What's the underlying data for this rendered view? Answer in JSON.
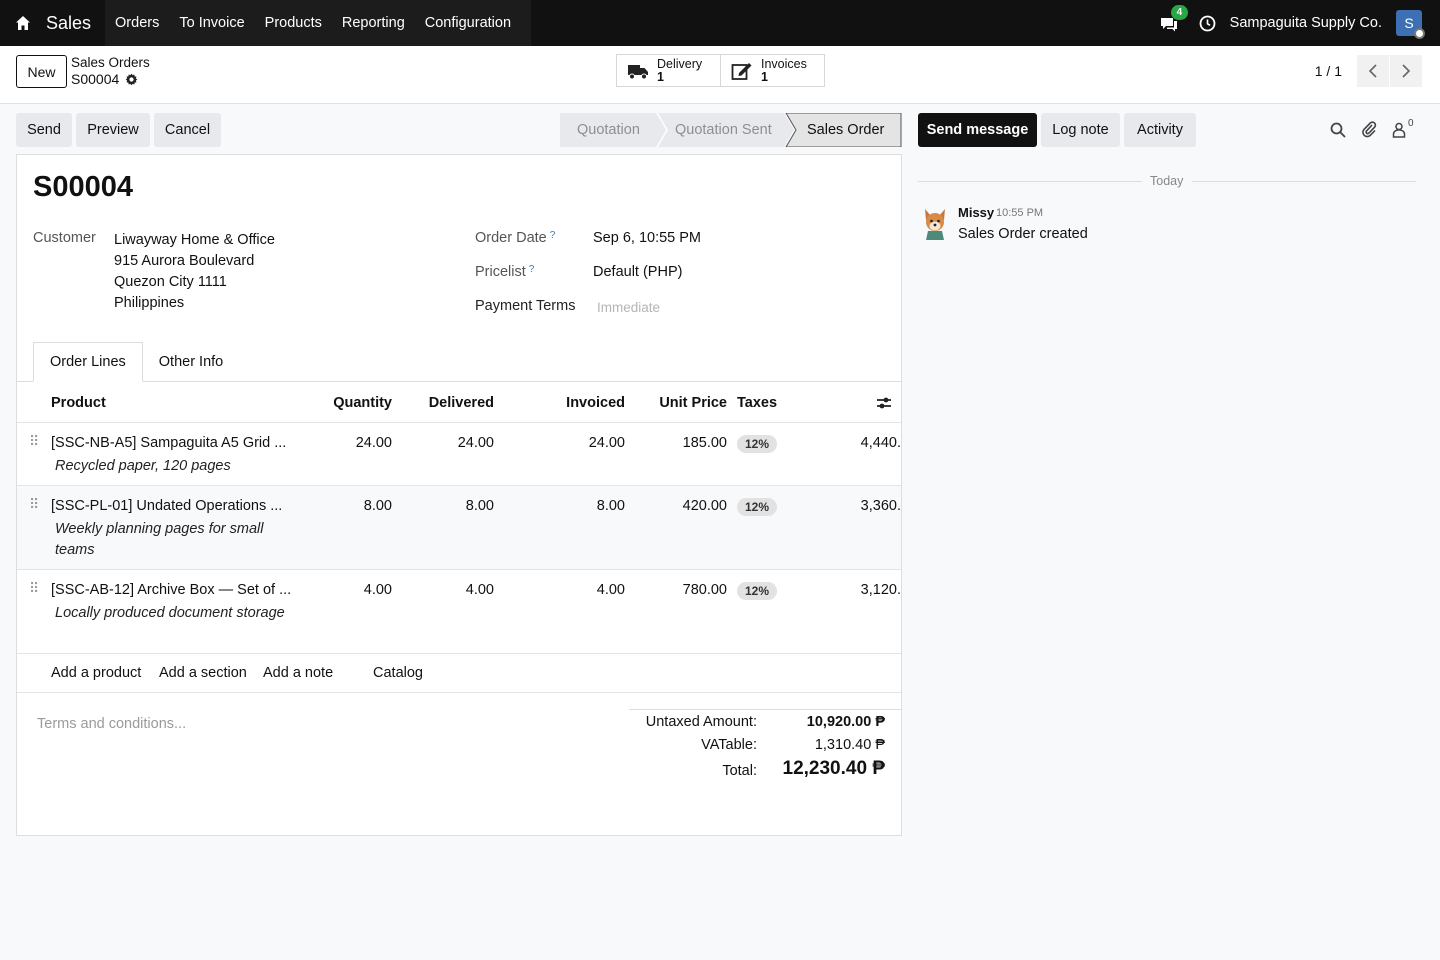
{
  "navbar": {
    "app_name": "Sales",
    "menu": [
      "Orders",
      "To Invoice",
      "Products",
      "Reporting",
      "Configuration"
    ],
    "chat_count": "4",
    "company": "Sampaguita Supply Co.",
    "avatar_initial": "S"
  },
  "control": {
    "new_label": "New",
    "breadcrumb_parent": "Sales Orders",
    "breadcrumb_current": "S00004",
    "smart_buttons": [
      {
        "label": "Delivery",
        "count": "1",
        "icon": "truck-icon"
      },
      {
        "label": "Invoices",
        "count": "1",
        "icon": "edit-invoice-icon"
      }
    ],
    "pager": "1 / 1"
  },
  "actions": {
    "send": "Send",
    "preview": "Preview",
    "cancel": "Cancel"
  },
  "statusbar": {
    "stages": [
      "Quotation",
      "Quotation Sent",
      "Sales Order"
    ],
    "active": "Sales Order"
  },
  "form": {
    "title": "S00004",
    "customer_label": "Customer",
    "customer_lines": [
      "Liwayway Home & Office",
      "915 Aurora Boulevard",
      "Quezon City 1111",
      "Philippines"
    ],
    "order_date_label": "Order Date",
    "order_date": "Sep 6, 10:55 PM",
    "pricelist_label": "Pricelist",
    "pricelist": "Default (PHP)",
    "payment_terms_label": "Payment Terms",
    "payment_terms_placeholder": "Immediate",
    "help_mark": "?",
    "tabs": [
      "Order Lines",
      "Other Info"
    ],
    "columns": {
      "product": "Product",
      "quantity": "Quantity",
      "delivered": "Delivered",
      "invoiced": "Invoiced",
      "unit_price": "Unit Price",
      "taxes": "Taxes"
    },
    "lines": [
      {
        "product": "[SSC-NB-A5] Sampaguita A5 Grid ...",
        "description": "Recycled paper, 120 pages",
        "quantity": "24.00",
        "delivered": "24.00",
        "invoiced": "24.00",
        "unit_price": "185.00",
        "tax": "12%",
        "subtotal": "4,440."
      },
      {
        "product": "[SSC-PL-01] Undated Operations ...",
        "description": "Weekly planning pages for small teams",
        "quantity": "8.00",
        "delivered": "8.00",
        "invoiced": "8.00",
        "unit_price": "420.00",
        "tax": "12%",
        "subtotal": "3,360."
      },
      {
        "product": "[SSC-AB-12] Archive Box — Set of ...",
        "description": "Locally produced document storage",
        "quantity": "4.00",
        "delivered": "4.00",
        "invoiced": "4.00",
        "unit_price": "780.00",
        "tax": "12%",
        "subtotal": "3,120."
      }
    ],
    "add_links": [
      "Add a product",
      "Add a section",
      "Add a note",
      "Catalog"
    ],
    "terms_placeholder": "Terms and conditions...",
    "totals": {
      "untaxed_label": "Untaxed Amount:",
      "untaxed": "10,920.00 ₱",
      "vatable_label": "VATable:",
      "vatable": "1,310.40 ₱",
      "total_label": "Total:",
      "total": "12,230.40 ₱"
    }
  },
  "chatter": {
    "send_message": "Send message",
    "log_note": "Log note",
    "activity": "Activity",
    "followers_count": "0",
    "today": "Today",
    "messages": [
      {
        "author": "Missy",
        "time": "10:55 PM",
        "body": "Sales Order created"
      }
    ]
  },
  "colors": {
    "navbar": "#111111",
    "primary_button": "#111111",
    "tax_badge": "#e2e2e2",
    "chat_badge": "#28a745"
  }
}
